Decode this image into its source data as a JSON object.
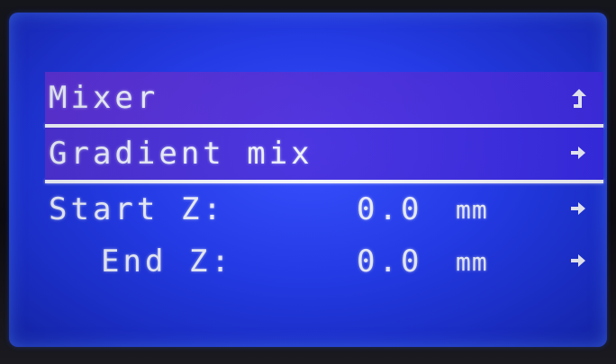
{
  "menu": {
    "title": "Mixer",
    "title_icon": "back-arrow-icon",
    "items": [
      {
        "label": "Gradient mix",
        "icon": "right-arrow-icon"
      },
      {
        "label": "Start Z:",
        "value": "0.0",
        "unit": "mm",
        "icon": "right-arrow-icon"
      },
      {
        "label": "End Z:",
        "value": "0.0",
        "unit": "mm",
        "icon": "right-arrow-icon"
      }
    ]
  },
  "colors": {
    "lcd_background": "#1f37f0",
    "highlight": "#4a2cdf",
    "text": "#eef2ff"
  }
}
